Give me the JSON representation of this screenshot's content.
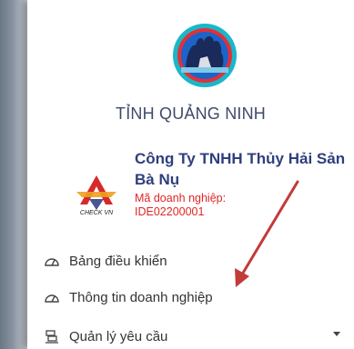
{
  "header": {
    "province": "TỈNH QUẢNG NINH",
    "logo_icon": "province-emblem-icon"
  },
  "company": {
    "name": "Công Ty TNHH Thủy Hải Sản Bà Nụ",
    "code_label": "Mã doanh nghiệp:",
    "code_value": "IDE02200001",
    "logo_text": "CHECK VN",
    "logo_icon": "checkvn-logo-icon"
  },
  "menu": [
    {
      "label": "Bảng điều khiển",
      "icon": "dashboard-gauge-icon"
    },
    {
      "label": "Thông tin doanh nghiệp",
      "icon": "dashboard-gauge-icon"
    },
    {
      "label": "Quản lý yêu cầu",
      "icon": "request-stack-icon",
      "has_dropdown": true
    }
  ],
  "colors": {
    "province_text": "#3f4a6a",
    "company_name": "#2e3f7d",
    "company_code": "#e02525",
    "annotation_arrow": "#c23a3a",
    "logo_ring": "#1ab7c8",
    "logo_inner": "#e2303a"
  }
}
